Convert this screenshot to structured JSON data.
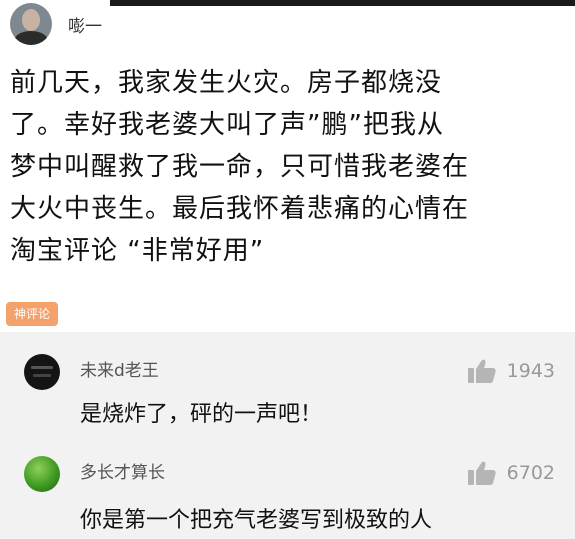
{
  "post": {
    "author": "嘭一",
    "lines": [
      "前几天，我家发生火灾。房子都烧没",
      "了。幸好我老婆大叫了声”鹏”把我从",
      "梦中叫醒救了我一命，只可惜我老婆在",
      "大火中丧生。最后我怀着悲痛的心情在",
      "淘宝评论 “非常好用”"
    ]
  },
  "badge": "神评论",
  "comments": [
    {
      "name": "未来d老王",
      "likes": "1943",
      "text": "是烧炸了，砰的一声吧！"
    },
    {
      "name": "多长才算长",
      "likes": "6702",
      "text": "你是第一个把充气老婆写到极致的人"
    }
  ],
  "icons": {
    "like": "thumbs-up-icon"
  },
  "colors": {
    "badge": "#f4a26b",
    "comment_bg": "#f2f2f2",
    "muted": "#999999"
  }
}
